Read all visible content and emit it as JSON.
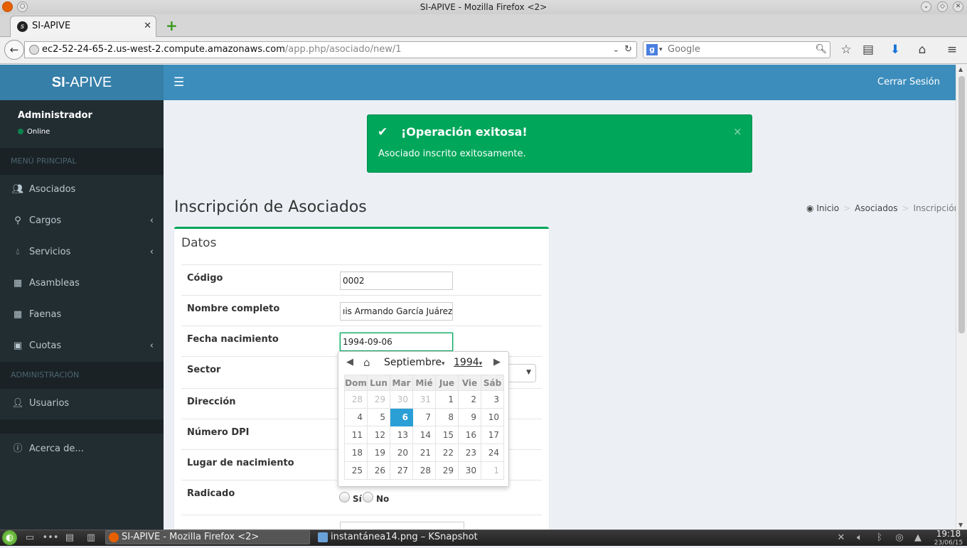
{
  "window": {
    "title": "SI-APIVE - Mozilla Firefox <2>"
  },
  "browser": {
    "tab_title": "SI-APIVE",
    "url_host": "ec2-52-24-65-2.us-west-2.compute.amazonaws.com",
    "url_path": "/app.php/asociado/new/1",
    "search_placeholder": "Google"
  },
  "app": {
    "logo_bold": "SI",
    "logo_rest": "-APIVE",
    "logout": "Cerrar Sesión"
  },
  "sidebar": {
    "user_name": "Administrador",
    "user_status": "Online",
    "header_main": "MENÚ PRINCIPAL",
    "header_admin": "ADMINISTRACIÓN",
    "items": [
      {
        "label": "Asociados",
        "icon": "users-icon"
      },
      {
        "label": "Cargos",
        "icon": "sitemap-icon"
      },
      {
        "label": "Servicios",
        "icon": "tint-icon"
      },
      {
        "label": "Asambleas",
        "icon": "calendar-icon"
      },
      {
        "label": "Faenas",
        "icon": "calendar-icon"
      },
      {
        "label": "Cuotas",
        "icon": "money-icon"
      },
      {
        "label": "Usuarios",
        "icon": "user-icon"
      },
      {
        "label": "Acerca de...",
        "icon": "info-icon"
      }
    ]
  },
  "alert": {
    "title": "¡Operación exitosa!",
    "message": "Asociado inscrito exitosamente.",
    "close": "×",
    "color": "#00a65a"
  },
  "page": {
    "title": "Inscripción de Asociados",
    "breadcrumb": [
      "Inicio",
      "Asociados",
      "Inscripción"
    ]
  },
  "form": {
    "box_title": "Datos",
    "fields": {
      "codigo_label": "Código",
      "codigo_value": "0002",
      "nombre_label": "Nombre completo",
      "nombre_value": "ıis Armando García Juárez",
      "fecha_label": "Fecha nacimiento",
      "fecha_value": "1994-09-06",
      "sector_label": "Sector",
      "direccion_label": "Dirección",
      "dpi_label": "Número DPI",
      "lugar_label": "Lugar de nacimiento",
      "radicado_label": "Radicado",
      "radicado_yes": "Sí",
      "radicado_no": "No"
    }
  },
  "datepicker": {
    "month": "Septiembre",
    "year": "1994",
    "weekdays": [
      "Dom",
      "Lun",
      "Mar",
      "Mié",
      "Jue",
      "Vie",
      "Sáb"
    ],
    "weeks": [
      [
        "28",
        "29",
        "30",
        "31",
        "1",
        "2",
        "3"
      ],
      [
        "4",
        "5",
        "6",
        "7",
        "8",
        "9",
        "10"
      ],
      [
        "11",
        "12",
        "13",
        "14",
        "15",
        "16",
        "17"
      ],
      [
        "18",
        "19",
        "20",
        "21",
        "22",
        "23",
        "24"
      ],
      [
        "25",
        "26",
        "27",
        "28",
        "29",
        "30",
        "1"
      ]
    ],
    "selected_day": "6",
    "selected_color": "#2a9fd6"
  },
  "taskbar": {
    "tasks": [
      "SI-APIVE - Mozilla Firefox <2>",
      "instantánea14.png – KSnapshot"
    ],
    "time": "19:18",
    "date": "23/06/15"
  }
}
